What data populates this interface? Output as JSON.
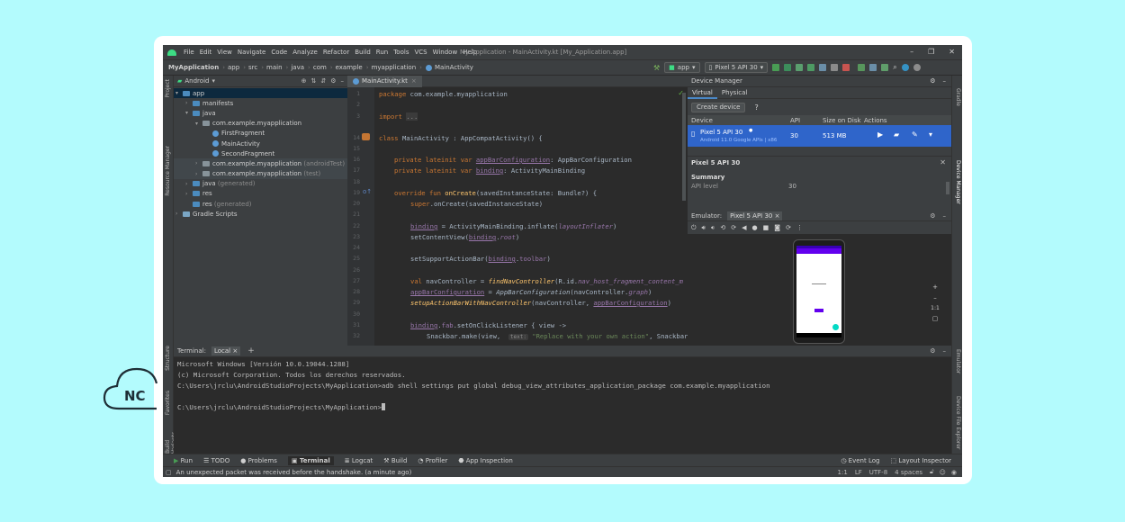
{
  "menu": [
    "File",
    "Edit",
    "View",
    "Navigate",
    "Code",
    "Analyze",
    "Refactor",
    "Build",
    "Run",
    "Tools",
    "VCS",
    "Window",
    "Help"
  ],
  "window_title": "My Application - MainActivity.kt [My_Application.app]",
  "breadcrumb": [
    "MyApplication",
    "app",
    "src",
    "main",
    "java",
    "com",
    "example",
    "myapplication",
    "MainActivity"
  ],
  "toolbar": {
    "run_config": "app",
    "device": "Pixel 5 API 30"
  },
  "project": {
    "view": "Android",
    "tree": [
      {
        "label": "app",
        "indent": 0
      },
      {
        "label": "manifests",
        "indent": 1
      },
      {
        "label": "java",
        "indent": 1
      },
      {
        "label": "com.example.myapplication",
        "indent": 2
      },
      {
        "label": "FirstFragment",
        "indent": 3
      },
      {
        "label": "MainActivity",
        "indent": 3
      },
      {
        "label": "SecondFragment",
        "indent": 3
      },
      {
        "label": "com.example.myapplication",
        "suffix": "(androidTest)",
        "indent": 2
      },
      {
        "label": "com.example.myapplication",
        "suffix": "(test)",
        "indent": 2
      },
      {
        "label": "java",
        "suffix": "(generated)",
        "indent": 1
      },
      {
        "label": "res",
        "indent": 1
      },
      {
        "label": "res",
        "suffix": "(generated)",
        "indent": 1
      },
      {
        "label": "Gradle Scripts",
        "indent": 0
      }
    ]
  },
  "editor": {
    "tab": "MainActivity.kt",
    "lines": [
      "1",
      "2",
      "3",
      "14",
      "15",
      "16",
      "17",
      "18",
      "19",
      "20",
      "21",
      "22",
      "23",
      "24",
      "25",
      "26",
      "27",
      "28",
      "29",
      "30",
      "31",
      "32"
    ]
  },
  "device_manager": {
    "title": "Device Manager",
    "tabs": [
      "Virtual",
      "Physical"
    ],
    "create_button": "Create device",
    "help": "?",
    "columns": [
      "Device",
      "API",
      "Size on Disk",
      "Actions"
    ],
    "device_name": "Pixel 5 API 30",
    "device_sub": "Android 11.0 Google APIs | x86",
    "device_api": "30",
    "device_size": "513 MB",
    "details_title": "Pixel 5 API 30",
    "summary_label": "Summary",
    "api_level_label": "API level",
    "api_level_value": "30"
  },
  "emulator": {
    "label": "Emulator:",
    "tab": "Pixel 5 API 30",
    "zoom": "1:1"
  },
  "terminal": {
    "label": "Terminal:",
    "tab": "Local",
    "lines": [
      "Microsoft Windows [Versión 10.0.19044.1288]",
      "(c) Microsoft Corporation. Todos los derechos reservados.",
      "C:\\Users\\jrclu\\AndroidStudioProjects\\MyApplication>adb shell settings put global debug_view_attributes_application_package com.example.myapplication",
      "",
      "C:\\Users\\jrclu\\AndroidStudioProjects\\MyApplication>"
    ]
  },
  "bottom_tools": [
    "Run",
    "TODO",
    "Problems",
    "Terminal",
    "Logcat",
    "Build",
    "Profiler",
    "App Inspection"
  ],
  "bottom_right": [
    "Event Log",
    "Layout Inspector"
  ],
  "status": {
    "message": "An unexpected packet was received before the handshake. (a minute ago)",
    "position": "1:1",
    "line_sep": "LF",
    "encoding": "UTF-8",
    "indent": "4 spaces"
  },
  "left_stripe": [
    "Project",
    "Resource Manager",
    "Structure",
    "Favorites",
    "Build Variants"
  ],
  "right_stripe": [
    "Gradle",
    "Device Manager",
    "Emulator",
    "Device File Explorer"
  ],
  "watermark": "NC"
}
